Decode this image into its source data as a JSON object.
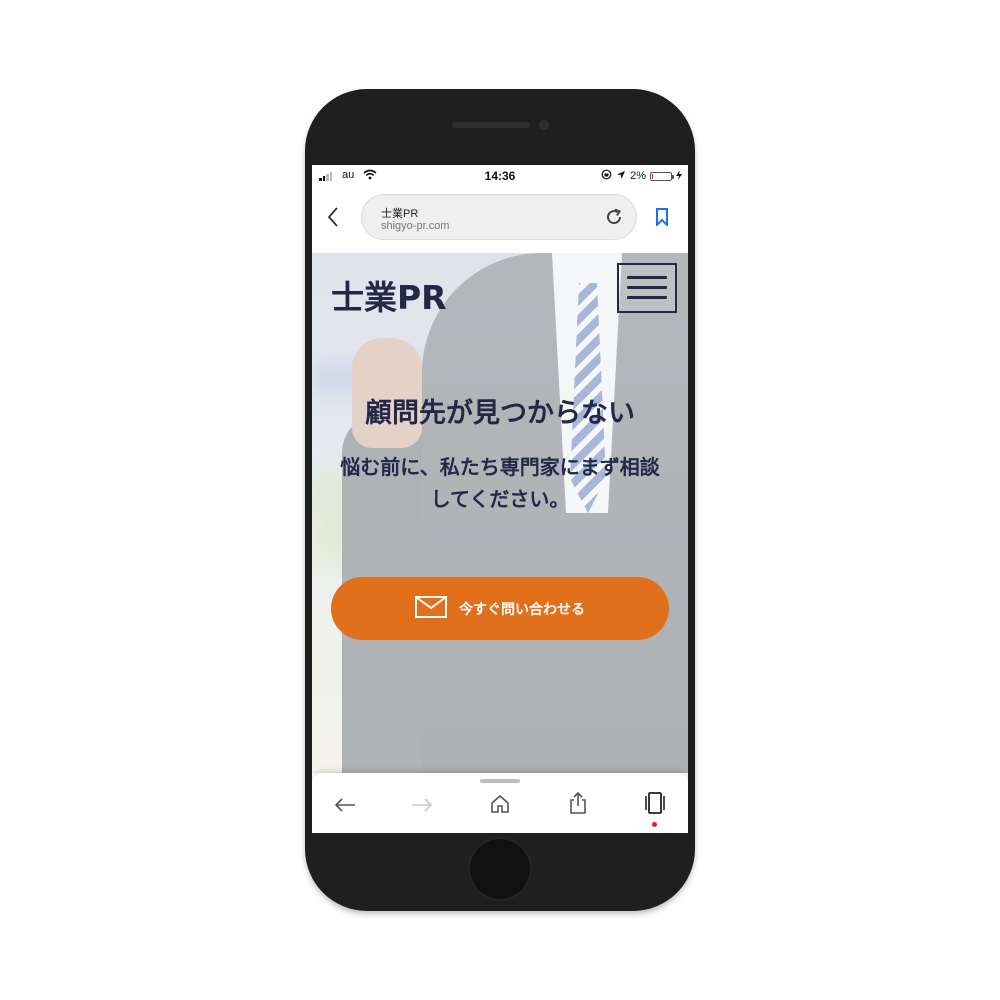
{
  "status_bar": {
    "carrier": "au",
    "time": "14:36",
    "battery_percent": "2%",
    "battery_level": 0.02,
    "signal_bars": 2,
    "low_battery_color": "#e0242a"
  },
  "browser": {
    "page_title": "士業PR",
    "host": "shigyo-pr.com",
    "accent_color": "#1a73e8",
    "icons": [
      "back-chevron-icon",
      "reload-icon",
      "bookmark-icon"
    ]
  },
  "site": {
    "logo": "士業PR",
    "brand_color": "#232849",
    "menu_icon": "hamburger-menu-icon"
  },
  "hero": {
    "headline": "顧問先が見つからない",
    "subtext": "悩む前に、私たち専門家にまず相談してください。"
  },
  "cta": {
    "label": "今すぐ問い合わせる",
    "icon": "envelope-icon",
    "color": "#e0701b"
  },
  "toolbar": {
    "buttons": [
      "back-arrow-icon",
      "forward-arrow-icon",
      "home-icon",
      "share-icon",
      "tabs-icon"
    ],
    "tabs_indicator_color": "#e0242a"
  }
}
